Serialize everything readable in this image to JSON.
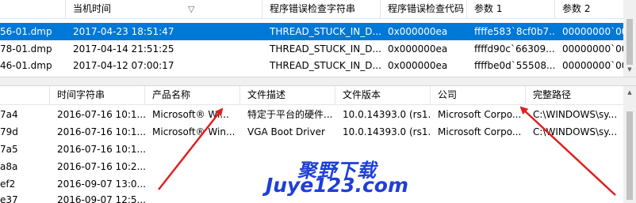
{
  "top": {
    "headers": [
      "",
      "当机时间",
      "程序错误检查字符串",
      "程序错误检查代码",
      "参数 1",
      "参数 2"
    ],
    "rows": [
      [
        "56-01.dmp",
        "2017-04-23 18:51:47",
        "THREAD_STUCK_IN_D...",
        "0x000000ea",
        "ffffe583`8cf0b7...",
        "00000000`00"
      ],
      [
        "78-01.dmp",
        "2017-04-14 21:51:25",
        "THREAD_STUCK_IN_D...",
        "0x000000ea",
        "ffffd90c`66309...",
        "00000000`00"
      ],
      [
        "46-01.dmp",
        "2017-04-12 07:00:17",
        "THREAD_STUCK_IN_D...",
        "0x000000ea",
        "ffffbe0d`55508...",
        "00000000`00"
      ]
    ]
  },
  "bottom": {
    "headers": [
      "",
      "时间字符串",
      "产品名称",
      "文件描述",
      "文件版本",
      "公司",
      "完整路径"
    ],
    "rows": [
      [
        "7a4",
        "2016-07-16 10:1...",
        "Microsoft® Wi...",
        "特定于平台的硬件...",
        "10.0.14393.0 (rs1...",
        "Microsoft Corpo...",
        "C:\\WINDOWS\\sy..."
      ],
      [
        "79d",
        "2016-07-16 10:1...",
        "Microsoft® Win...",
        "VGA Boot Driver",
        "10.0.14393.0 (rs1...",
        "Microsoft Corpo...",
        "C:\\WINDOWS\\sy..."
      ],
      [
        "7a5",
        "2016-07-16 10:1...",
        "",
        "",
        "",
        "",
        ""
      ],
      [
        "a8a",
        "2016-07-16 10:2...",
        "",
        "",
        "",
        "",
        ""
      ],
      [
        "ef2",
        "2016-09-07 13:0...",
        "",
        "",
        "",
        "",
        ""
      ],
      [
        "e37",
        "2016-09-07 12:5...",
        "",
        "",
        "",
        "",
        ""
      ]
    ]
  },
  "watermark": {
    "cn": "聚野下载",
    "en": "Juye123.com"
  },
  "colors": {
    "selection": "#0078d7",
    "annotation_arrow": "#e02020",
    "watermark": "#1f3fd6"
  }
}
